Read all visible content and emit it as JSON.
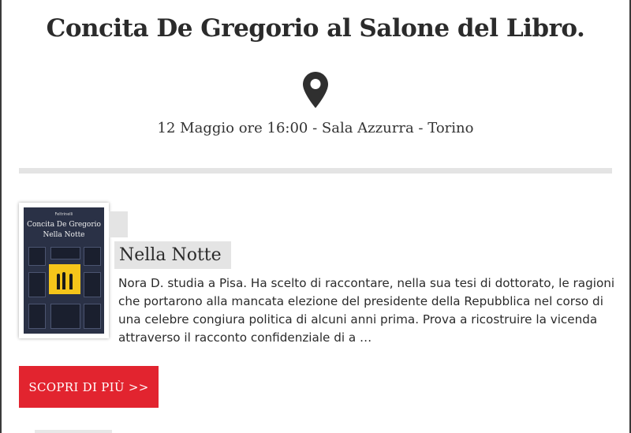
{
  "event": {
    "title": "Concita De Gregorio al Salone del Libro.",
    "location_icon": "map-pin-icon",
    "meta": "12 Maggio ore 16:00 - Sala Azzurra - Torino"
  },
  "book": {
    "cover": {
      "publisher": "Feltrinelli",
      "author": "Concita De Gregorio",
      "title": "Nella Notte",
      "colors": {
        "background": "#2a3146",
        "lit_window": "#f5c51a"
      }
    },
    "title": "Nella Notte",
    "description": "Nora D. studia a Pisa. Ha scelto di raccontare, nella sua tesi di dottorato, le ragioni che portarono alla mancata elezione del presidente della Repubblica nel corso di una celebre congiura politica di alcuni anni prima. Prova a ricostruire la vicenda attraverso il racconto confidenziale di a …"
  },
  "cta": {
    "label": "SCOPRI DI PIÙ >>",
    "color": "#e2242f"
  }
}
